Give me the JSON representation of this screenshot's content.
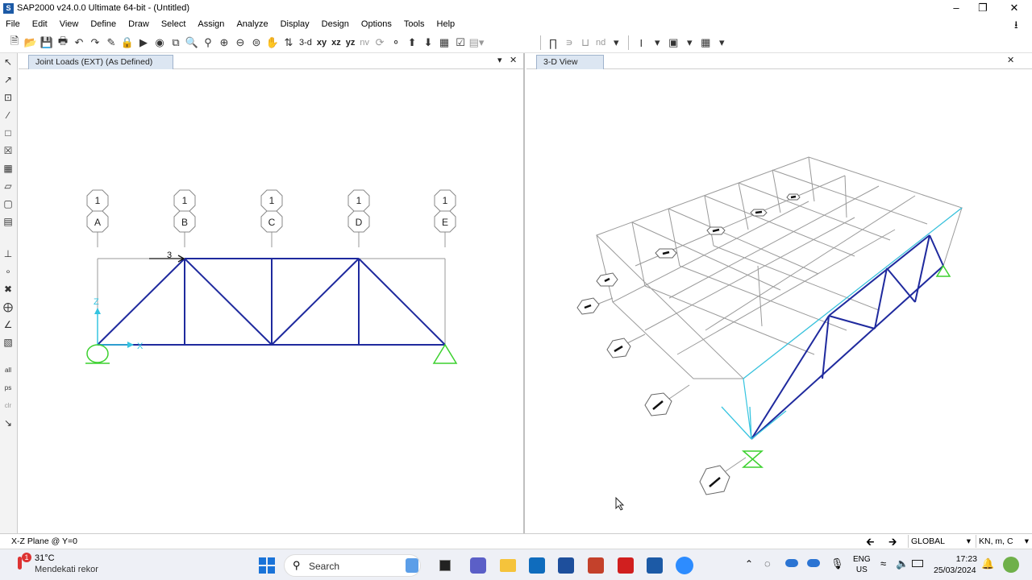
{
  "window": {
    "title": "SAP2000 v24.0.0 Ultimate 64-bit - (Untitled)",
    "app_icon": "S"
  },
  "menu": [
    "File",
    "Edit",
    "View",
    "Define",
    "Draw",
    "Select",
    "Assign",
    "Analyze",
    "Display",
    "Design",
    "Options",
    "Tools",
    "Help"
  ],
  "toolbar": {
    "view_3d": "3-d",
    "view_xy": "xy",
    "view_xz": "xz",
    "view_yz": "yz",
    "view_nv": "nv",
    "nd": "nd"
  },
  "left_pane": {
    "tab": "Joint Loads (EXT) (As Defined)",
    "grid_top_labels": [
      "1",
      "1",
      "1",
      "1",
      "1"
    ],
    "grid_labels": [
      "A",
      "B",
      "C",
      "D",
      "E"
    ],
    "load_value": "3",
    "axis_z": "Z",
    "axis_x": "X"
  },
  "right_pane": {
    "tab": "3-D View"
  },
  "status": {
    "plane": "X-Z Plane @ Y=0",
    "coord_system": "GLOBAL",
    "units": "KN, m, C"
  },
  "taskbar": {
    "weather_temp": "31°C",
    "weather_text": "Mendekati rekor",
    "weather_badge": "1",
    "search_label": "Search",
    "lang_line1": "ENG",
    "lang_line2": "US",
    "time": "17:23",
    "date": "25/03/2024"
  },
  "colors": {
    "truss": "#1f2a9e",
    "support": "#3cd12f",
    "axis": "#35c4e0",
    "grid": "#9a9a9a"
  }
}
